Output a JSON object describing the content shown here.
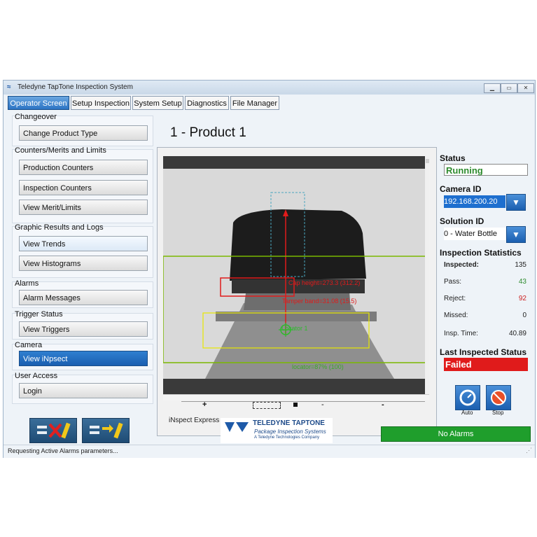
{
  "window": {
    "title": "Teledyne TapTone Inspection System"
  },
  "tabs": [
    {
      "label": "Operator Screen"
    },
    {
      "label": "Setup Inspection"
    },
    {
      "label": "System Setup"
    },
    {
      "label": "Diagnostics"
    },
    {
      "label": "File Manager"
    }
  ],
  "sidebar": {
    "changeover": {
      "title": "Changeover",
      "buttons": [
        "Change Product Type"
      ]
    },
    "counters": {
      "title": "Counters/Merits and Limits",
      "buttons": [
        "Production Counters",
        "Inspection Counters",
        "View Merit/Limits"
      ]
    },
    "graphic": {
      "title": "Graphic Results and Logs",
      "buttons": [
        "View Trends",
        "View Histograms"
      ]
    },
    "alarms": {
      "title": "Alarms",
      "buttons": [
        "Alarm Messages"
      ]
    },
    "trigger": {
      "title": "Trigger Status",
      "buttons": [
        "View Triggers"
      ]
    },
    "camera": {
      "title": "Camera",
      "buttons": [
        "View iNpsect"
      ]
    },
    "user": {
      "title": "User Access",
      "buttons": [
        "Login"
      ]
    }
  },
  "product": {
    "title": "1 - Product 1"
  },
  "overlay": {
    "cap_height": "Cap height=273.3 (312.2)",
    "tamper_band": "Tamper band=31.08 (15.5)",
    "locator_small": "Locator 1",
    "locator": "locator=87% (100)"
  },
  "image_toolbar": {
    "plus": "+",
    "minus": "-"
  },
  "brand": {
    "inspect_label": "iNspect Express",
    "company": "TELEDYNE TAPTONE",
    "tagline": "Package Inspection Systems",
    "subtagline": "A Teledyne Technologies Company"
  },
  "status": {
    "status_label": "Status",
    "status_value": "Running",
    "camera_label": "Camera ID",
    "camera_value": "192.168.200.20",
    "solution_label": "Solution ID",
    "solution_value": "0 - Water Bottle",
    "stats_label": "Inspection Statistics",
    "stats": [
      {
        "label": "Inspected:",
        "value": "135",
        "color": "#222222"
      },
      {
        "label": "Pass:",
        "value": "43",
        "color": "#2e8b2e"
      },
      {
        "label": "Reject:",
        "value": "92",
        "color": "#cc2222"
      },
      {
        "label": "Missed:",
        "value": "0",
        "color": "#222222"
      },
      {
        "label": "Insp. Time:",
        "value": "40.89",
        "color": "#222222"
      }
    ],
    "last_label": "Last Inspected Status",
    "last_value": "Failed"
  },
  "controls": {
    "auto_label": "Auto",
    "stop_label": "Stop"
  },
  "alarm_bar": {
    "text": "No Alarms"
  },
  "statusbar": {
    "text": "Requesting Active Alarms parameters..."
  },
  "colors": {
    "accent": "#1b5fb0",
    "running": "#2e8b2e",
    "failed": "#e01b1b",
    "no_alarms": "#1f9e2c"
  }
}
